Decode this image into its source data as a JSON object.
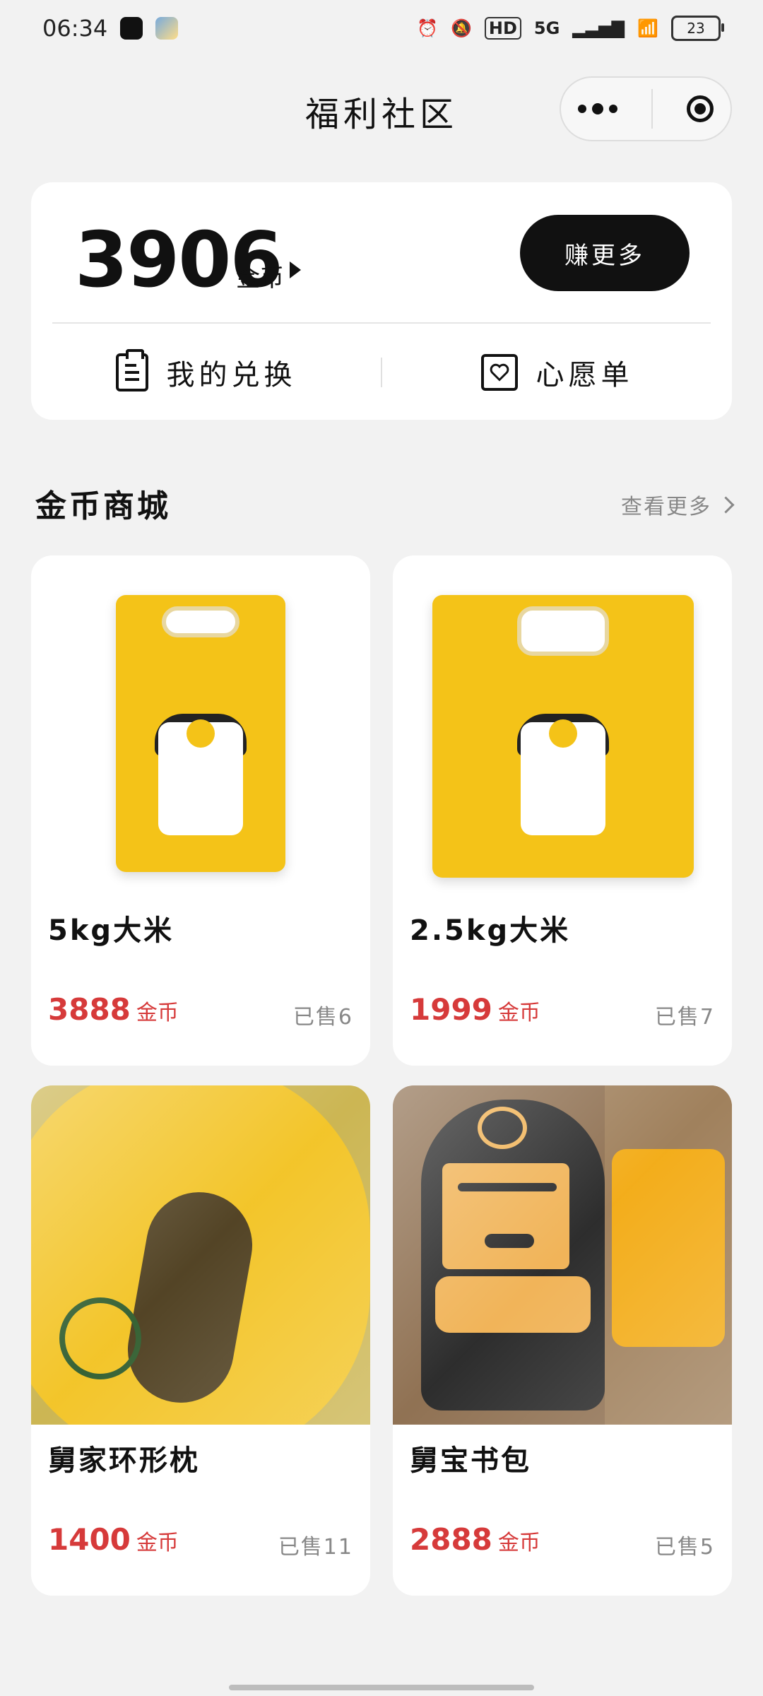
{
  "status_bar": {
    "time": "06:34",
    "network": "5G",
    "hd": "HD",
    "battery": "23"
  },
  "navbar": {
    "title": "福利社区"
  },
  "coins_card": {
    "amount": "3906",
    "unit": "金币",
    "earn_button": "赚更多",
    "actions": [
      {
        "label": "我的兑换",
        "icon": "clipboard-icon"
      },
      {
        "label": "心愿单",
        "icon": "heart-icon"
      }
    ]
  },
  "section": {
    "title": "金币商城",
    "view_more": "查看更多"
  },
  "products": [
    {
      "name": "5kg大米",
      "price": "3888",
      "unit": "金币",
      "sold": "已售6"
    },
    {
      "name": "2.5kg大米",
      "price": "1999",
      "unit": "金币",
      "sold": "已售7"
    },
    {
      "name": "舅家环形枕",
      "price": "1400",
      "unit": "金币",
      "sold": "已售11"
    },
    {
      "name": "舅宝书包",
      "price": "2888",
      "unit": "金币",
      "sold": "已售5"
    }
  ],
  "colors": {
    "price": "#d63a3a",
    "primary": "#111111",
    "background": "#f2f2f2"
  }
}
